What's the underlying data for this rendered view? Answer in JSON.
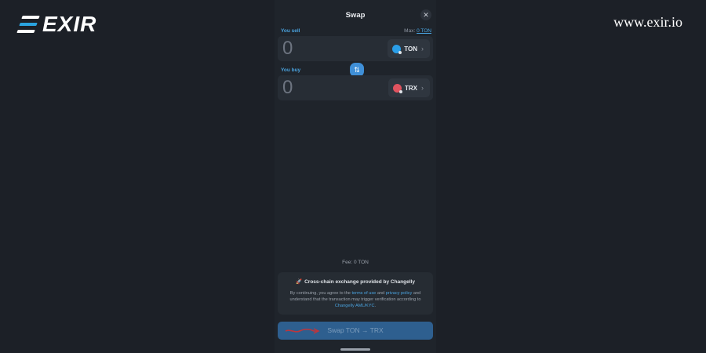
{
  "brand": {
    "logo_text": "EXIR",
    "site_url": "www.exir.io"
  },
  "screen": {
    "title": "Swap",
    "close_glyph": "✕",
    "sell": {
      "label": "You sell",
      "max_label": "Max:",
      "max_value": "0 TON",
      "amount": "0",
      "token": "TON",
      "token_icon": "ton-coin-icon"
    },
    "swap_glyph": "⇅",
    "buy": {
      "label": "You buy",
      "amount": "0",
      "token": "TRX",
      "token_icon": "trx-coin-icon"
    },
    "chevron_glyph": "›",
    "fee": "Fee: 0 TON",
    "info": {
      "rocket": "🚀",
      "title": "Cross-chain exchange provided by Changelly",
      "text_1": "By continuing, you agree to the ",
      "terms_link": "terms of use",
      "text_2": " and ",
      "privacy_link": "privacy policy",
      "text_3": " and understand that the transaction may trigger verification according to ",
      "aml_link": "Changelly AML/KYC",
      "text_4": "."
    },
    "cta_label": "Swap TON → TRX"
  },
  "colors": {
    "accent": "#4aa3df",
    "background": "#1c2027",
    "ton": "#2a9ee8",
    "trx": "#e0535f",
    "annotation": "#c0353b"
  }
}
